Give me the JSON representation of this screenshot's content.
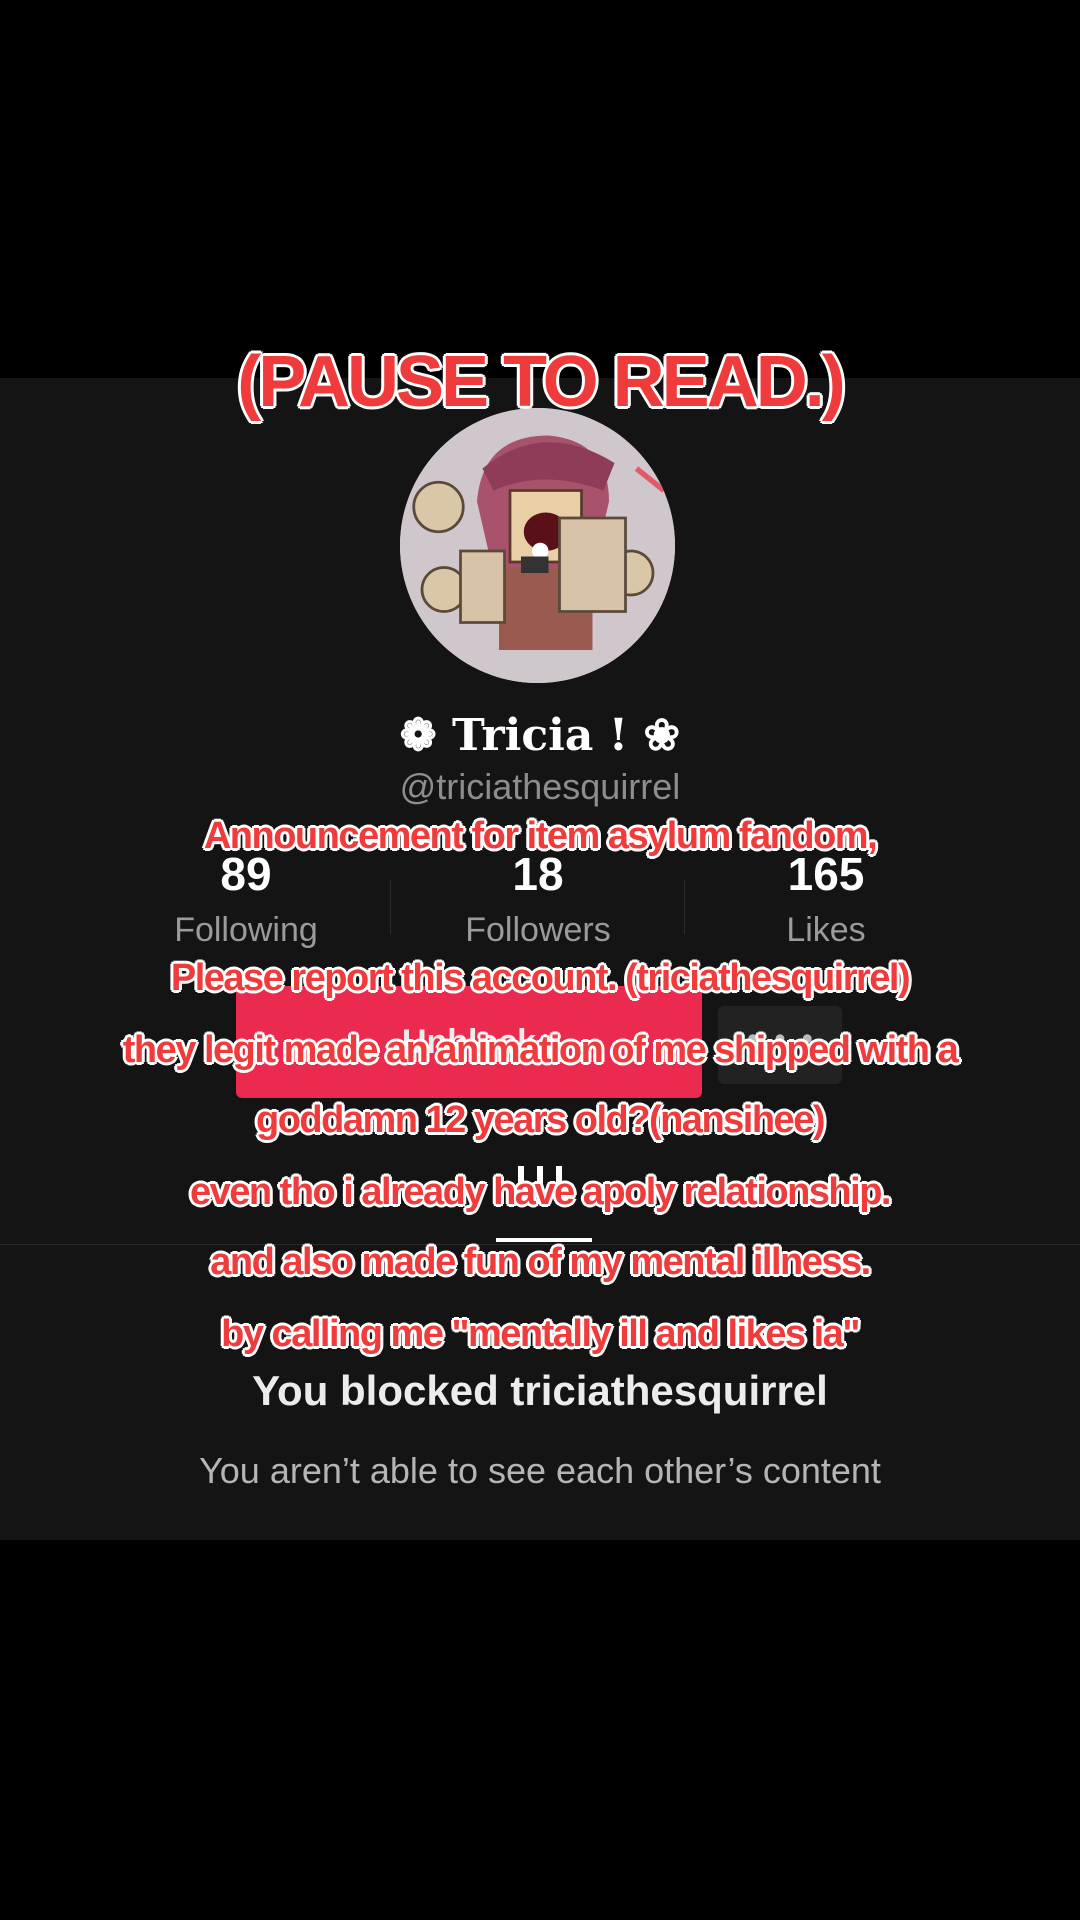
{
  "overlay": {
    "title": "(PAUSE TO READ.)",
    "lines": [
      "Announcement for item asylum fandom,",
      "Please report this account. (triciathesquirrel)",
      "they legit made an animation of me shipped with a",
      "goddamn 12 years old?(nansihee)",
      "even tho i already have apoly relationship.",
      "and also made fun of my mental illness.",
      "by calling me \"mentally ill and likes ia\""
    ],
    "text_color": "#ef3b3b"
  },
  "profile": {
    "display_name": "❁ Tricia ! ❀",
    "handle": "@triciathesquirrel",
    "avatar_icon": "avatar-image",
    "stats": [
      {
        "value": "89",
        "label": "Following"
      },
      {
        "value": "18",
        "label": "Followers"
      },
      {
        "value": "165",
        "label": "Likes"
      }
    ],
    "unblock_label": "Unblock",
    "more_icon": "more-options-icon",
    "tab_icon": "videos-grid-icon"
  },
  "blocked": {
    "title": "You blocked triciathesquirrel",
    "subtitle": "You aren’t able to see each other’s content"
  },
  "colors": {
    "background": "#000000",
    "panel": "#141414",
    "accent": "#fe2c55"
  }
}
